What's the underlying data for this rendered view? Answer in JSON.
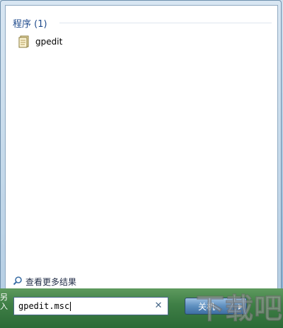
{
  "results": {
    "section_title": "程序 (1)",
    "items": [
      {
        "label": "gpedit",
        "icon": "document-icon"
      }
    ],
    "see_more_label": "查看更多结果"
  },
  "search": {
    "value": "gpedit.msc",
    "clear_icon": "close-icon"
  },
  "shutdown": {
    "label": "关机",
    "arrow_icon": "triangle-right-icon"
  },
  "strip": {
    "edge_text": "另入"
  },
  "watermark": {
    "text": "下载吧"
  },
  "colors": {
    "accent": "#1e4a8c",
    "strip": "#3f7f46",
    "button": "#5e8fbf"
  }
}
